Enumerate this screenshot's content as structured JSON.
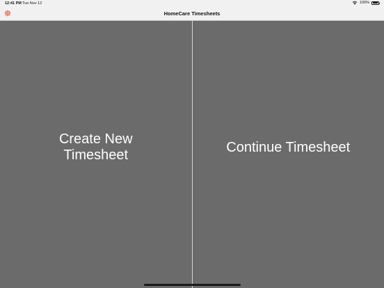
{
  "status_bar": {
    "time": "12:41 PM",
    "date": "Tue Nov 12",
    "battery": "100%"
  },
  "nav_bar": {
    "title": "HomeCare Timesheets",
    "settings_icon": "gear-icon",
    "accent_color": "#e8542f"
  },
  "main": {
    "left_button_label": "Create New Timesheet",
    "right_button_label": "Continue Timesheet"
  },
  "colors": {
    "background": "#6b6b6b",
    "text": "#ffffff",
    "nav_background": "#f1f1f1"
  }
}
